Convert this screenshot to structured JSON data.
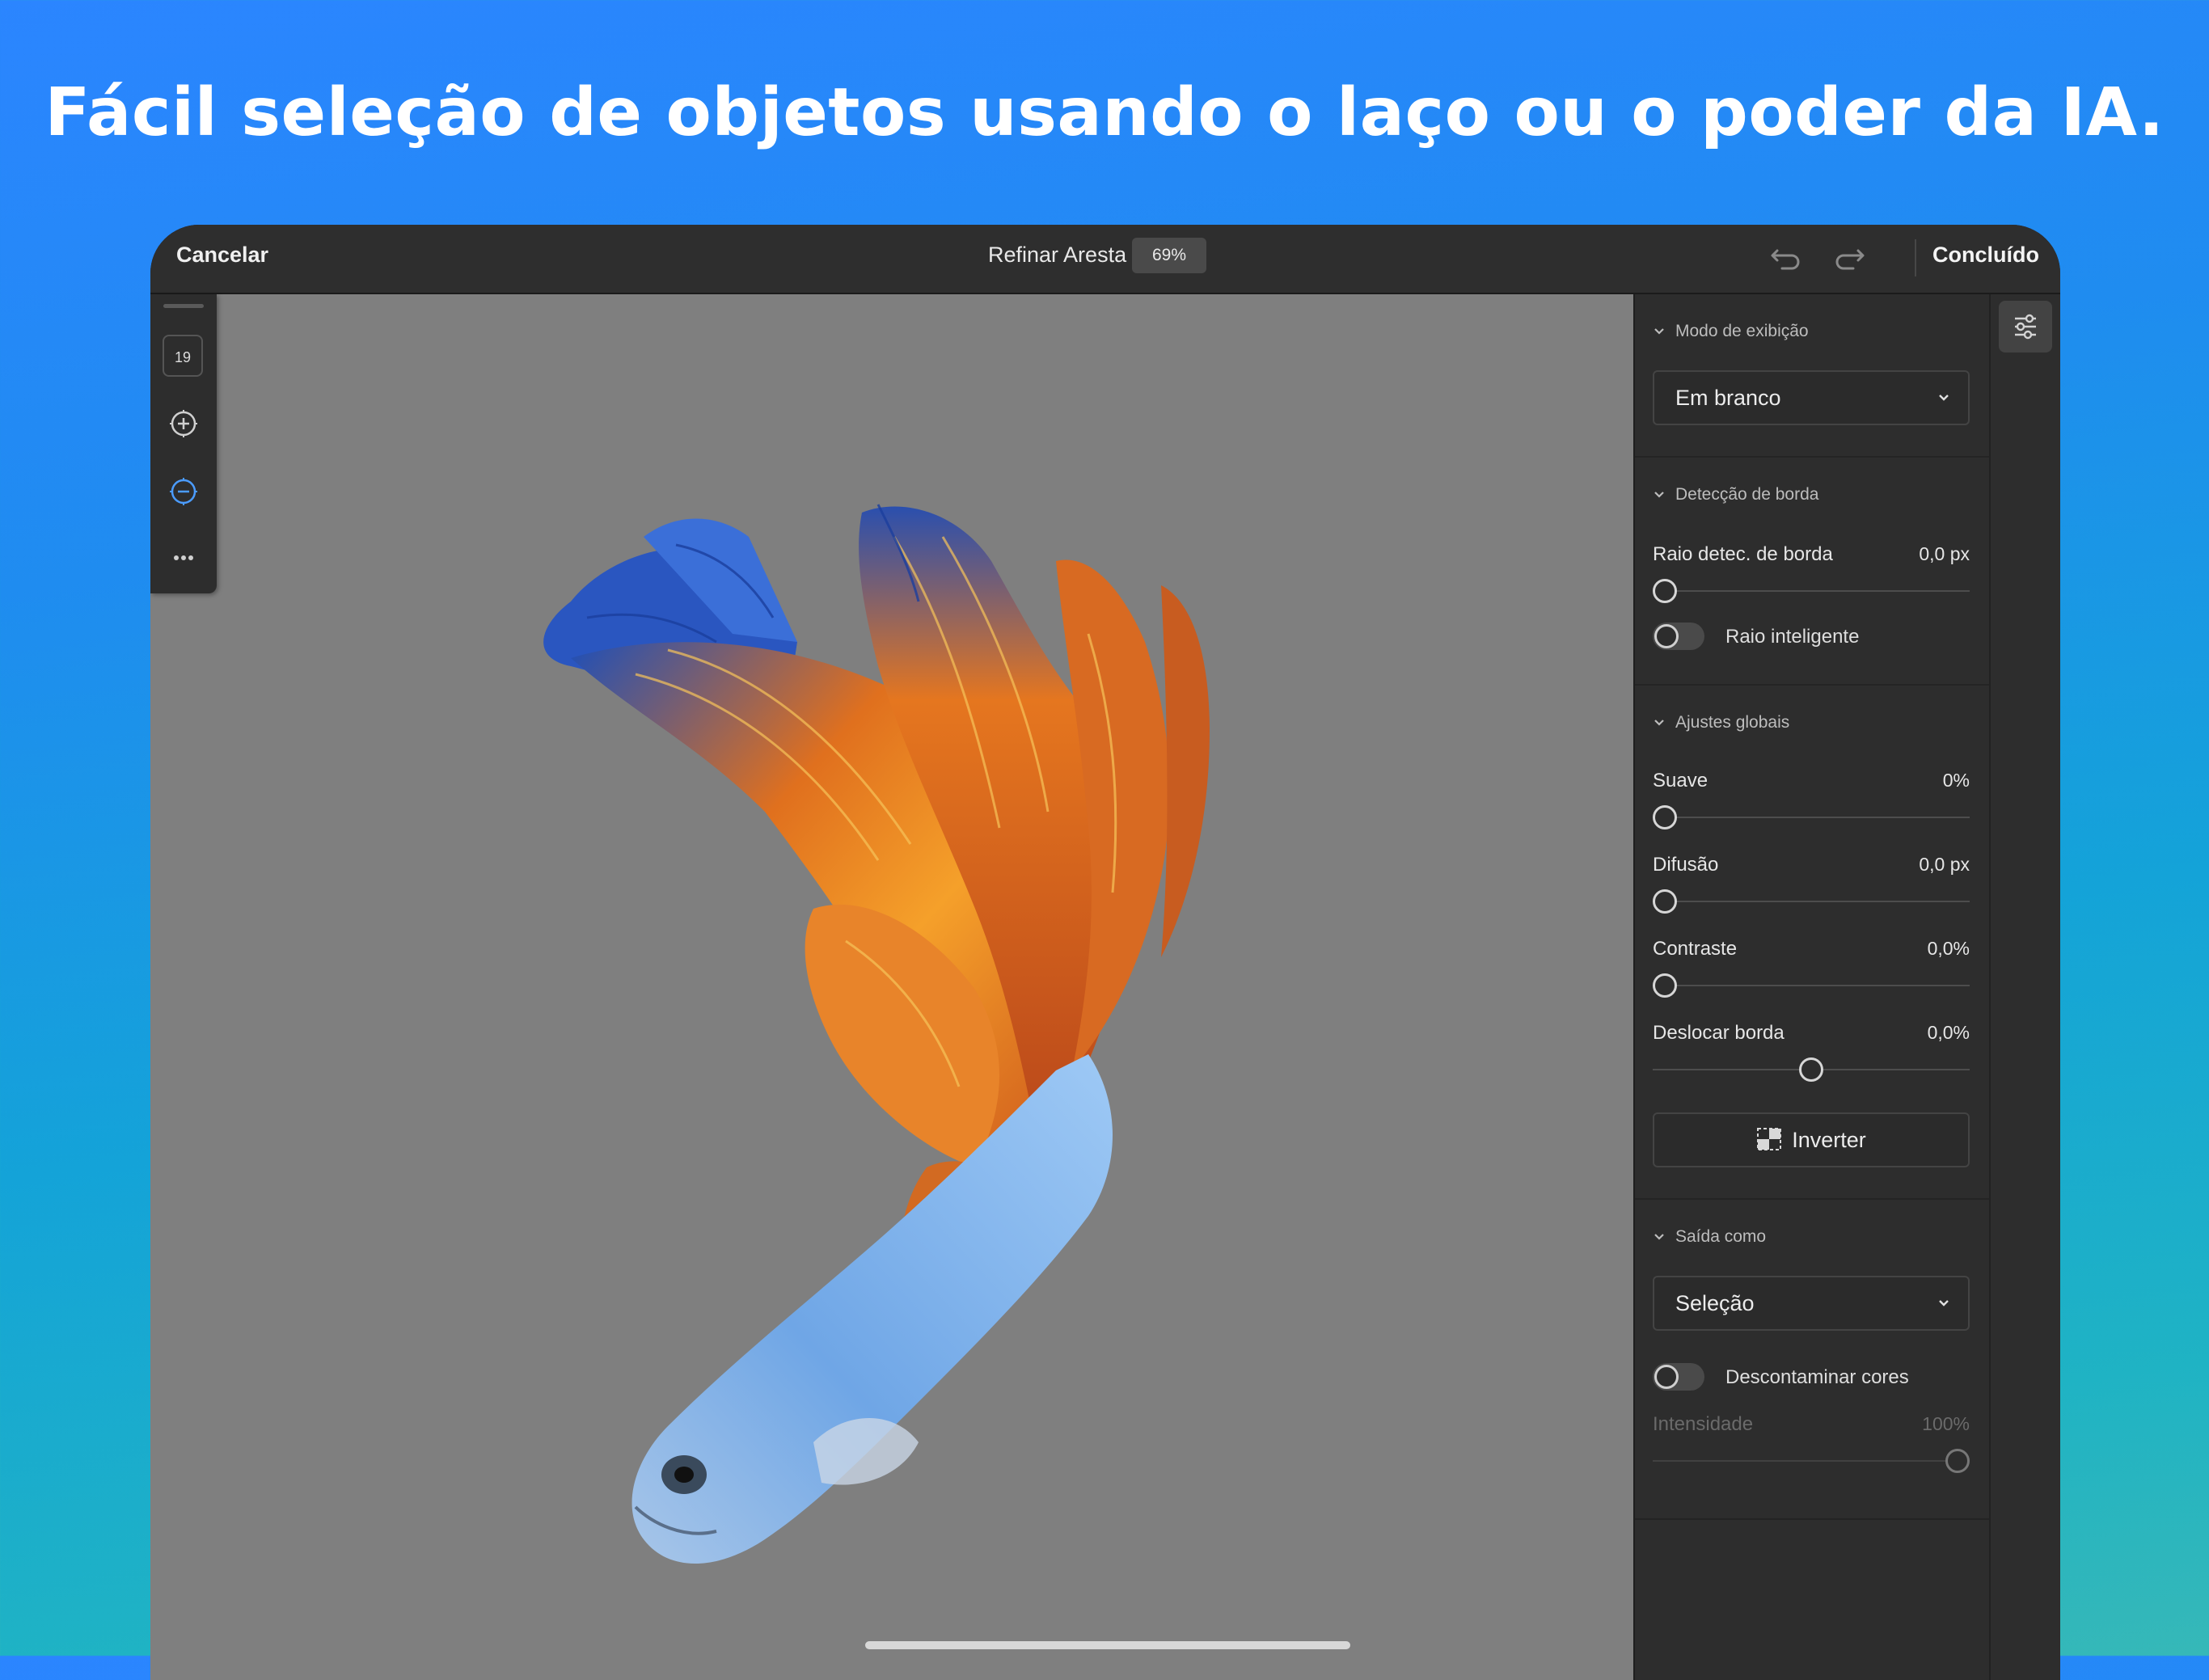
{
  "headline": "Fácil seleção de objetos usando o laço ou o poder da IA.",
  "topbar": {
    "cancel_label": "Cancelar",
    "title": "Refinar Aresta",
    "zoom": "69%",
    "done_label": "Concluído"
  },
  "toolrail": {
    "brush_size": "19"
  },
  "panel": {
    "view_mode": {
      "header": "Modo de exibição",
      "selected": "Em branco"
    },
    "edge_detection": {
      "header": "Detecção de borda",
      "radius_label": "Raio detec. de borda",
      "radius_value": "0,0 px",
      "smart_radius_label": "Raio inteligente",
      "smart_radius_on": false
    },
    "global_adjustments": {
      "header": "Ajustes globais",
      "smooth_label": "Suave",
      "smooth_value": "0%",
      "feather_label": "Difusão",
      "feather_value": "0,0 px",
      "contrast_label": "Contraste",
      "contrast_value": "0,0%",
      "shift_edge_label": "Deslocar borda",
      "shift_edge_value": "0,0%",
      "invert_label": "Inverter"
    },
    "output": {
      "header": "Saída como",
      "selected": "Seleção",
      "decontaminate_label": "Descontaminar cores",
      "decontaminate_on": false,
      "intensity_label": "Intensidade",
      "intensity_value": "100%"
    }
  },
  "sliders": {
    "radius": 0,
    "smooth": 0,
    "feather": 0,
    "contrast": 0,
    "shift_edge": 0.5,
    "intensity": 1
  },
  "icons": {
    "undo": "undo-icon",
    "redo": "redo-icon",
    "add_brush": "plus-circle-icon",
    "subtract_brush": "minus-circle-icon",
    "more": "more-icon",
    "properties": "sliders-icon",
    "invert": "invert-icon"
  },
  "colors": {
    "accent": "#4b9cff",
    "canvas_bg": "#7f7f7f",
    "panel_bg": "#2d2d2d"
  }
}
